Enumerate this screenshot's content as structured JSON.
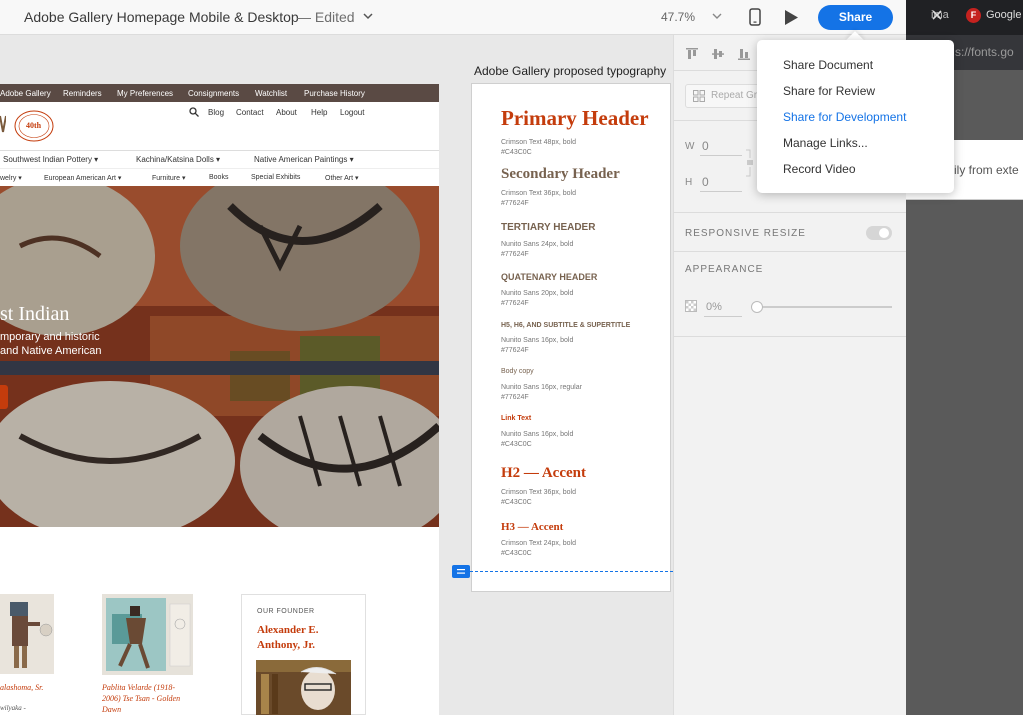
{
  "titlebar": {
    "title": "Adobe Gallery Homepage Mobile & Desktop",
    "status": "— Edited",
    "zoom": "47.7%",
    "share_label": "Share"
  },
  "share_menu": {
    "items": [
      {
        "label": "Share Document"
      },
      {
        "label": "Share for Review"
      },
      {
        "label": "Share for Development",
        "active": true
      },
      {
        "label": "Manage Links..."
      },
      {
        "label": "Record Video"
      }
    ]
  },
  "browser": {
    "tab_partial": "ima",
    "tab_favicon_letter": "F",
    "tab_label": "Google",
    "address_partial": "s://fonts.go",
    "page_partial_text": "ily from exte"
  },
  "properties": {
    "repeat_grid_label": "Repeat Gr",
    "w_label": "W",
    "w_value": "0",
    "h_label": "H",
    "h_value": "0",
    "responsive_resize_label": "RESPONSIVE RESIZE",
    "appearance_label": "APPEARANCE",
    "opacity_value": "0%"
  },
  "site": {
    "topnav": [
      "Adobe Gallery",
      "Reminders",
      "My Preferences",
      "Consignments",
      "Watchlist",
      "Purchase History"
    ],
    "logo_seal_text": "40th",
    "utility_links": [
      "Blog",
      "Contact",
      "About",
      "Help",
      "Logout"
    ],
    "category_nav_1": [
      "Southwest Indian Pottery ▾",
      "Kachina/Katsina Dolls ▾",
      "Native American Paintings ▾"
    ],
    "category_nav_2": [
      "welry ▾",
      "European American Art ▾",
      "Furniture ▾",
      "Books",
      "Special Exhibits",
      "Other Art ▾"
    ],
    "hero_title": "st Indian",
    "hero_sub1": "mporary and historic",
    "hero_sub2": "and Native American",
    "product1_caption": "alashoma, Sr.",
    "product1_sub": "wilyaka -",
    "product2_caption_lines": [
      "Pablita Velarde (1918-",
      "2006) Tse Tsan - Golden",
      "Dawn"
    ],
    "founder_kicker": "OUR FOUNDER",
    "founder_name_lines": [
      "Alexander E.",
      "Anthony, Jr."
    ]
  },
  "typography": {
    "artboard_label": "Adobe Gallery proposed typography",
    "specs": [
      {
        "name": "Primary Header",
        "meta1": "Crimson Text 48px, bold",
        "meta2": "#C43C0C"
      },
      {
        "name": "Secondary Header",
        "meta1": "Crimson Text 36px, bold",
        "meta2": "#77624F"
      },
      {
        "name": "TERTIARY HEADER",
        "meta1": "Nunito Sans 24px, bold",
        "meta2": "#77624F"
      },
      {
        "name": "QUATENARY HEADER",
        "meta1": "Nunito Sans 20px, bold",
        "meta2": "#77624F"
      },
      {
        "name": "H5, H6, AND SUBTITLE & SUPERTITLE",
        "meta1": "Nunito Sans 16px, bold",
        "meta2": "#77624F"
      },
      {
        "name": "Body copy",
        "meta1": "Nunito Sans 16px, regular",
        "meta2": "#77624F"
      },
      {
        "name": "Link Text",
        "meta1": "Nunito Sans 16px, bold",
        "meta2": "#C43C0C"
      },
      {
        "name": "H2 — Accent",
        "meta1": "Crimson Text 36px, bold",
        "meta2": "#C43C0C"
      },
      {
        "name": "H3 — Accent",
        "meta1": "Crimson Text 24px, bold",
        "meta2": "#C43C0C"
      }
    ]
  },
  "colors": {
    "accent": "#1473e6",
    "brand_red": "#C43C0C",
    "brand_brown": "#77624F",
    "topnav_bg": "#5a4a44"
  },
  "icons": [
    "chevron-down-icon",
    "mobile-device-icon",
    "play-icon",
    "close-icon",
    "lock-icon",
    "repeat-grid-icon",
    "opacity-checker-icon",
    "search-icon",
    "align-top-icon",
    "align-middle-icon",
    "align-bottom-icon"
  ]
}
